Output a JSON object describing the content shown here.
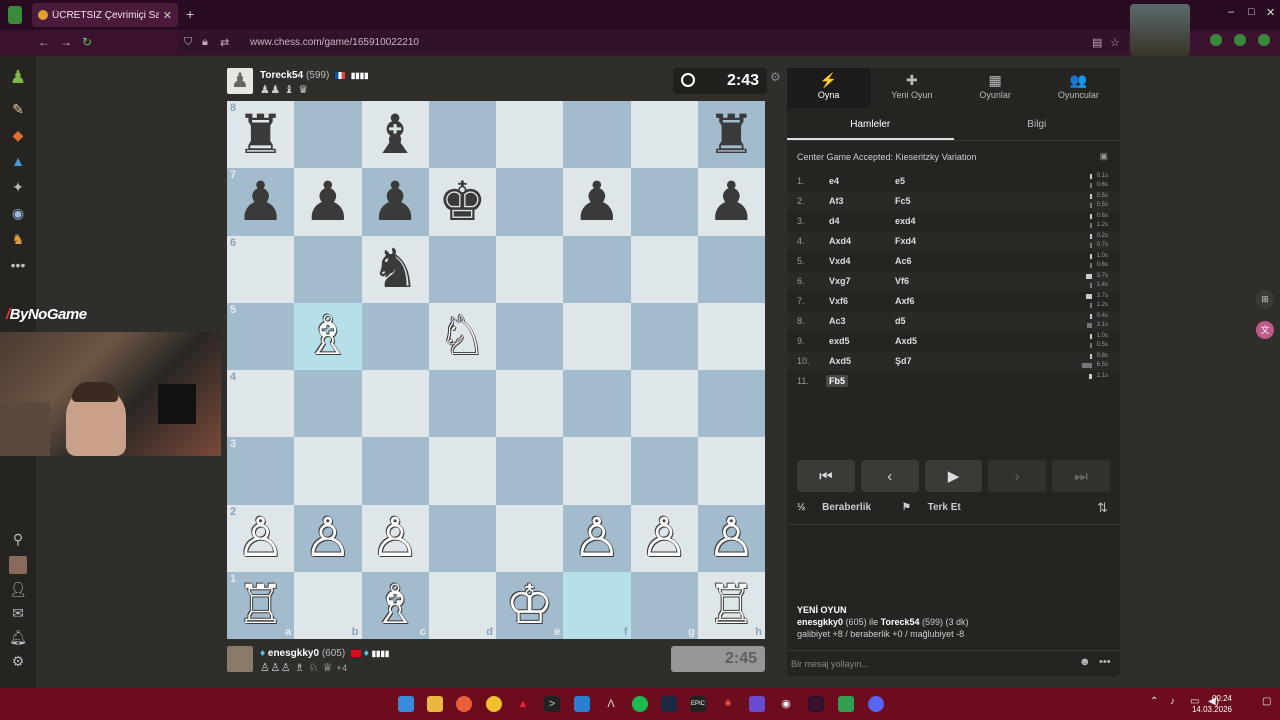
{
  "browser": {
    "tab_title": "ÜCRETSİZ Çevrimiçi Satranç",
    "url": "www.chess.com/game/165910022210"
  },
  "stream": {
    "brand": "ByNoGame",
    "brand_mark": "/"
  },
  "top_player": {
    "name": "Toreck54",
    "rating": "(599)",
    "captured": "♟♟ ♝ ♛",
    "clock": "2:43"
  },
  "bottom_player": {
    "name": "enesgkky0",
    "rating": "(605)",
    "captured": "♙♙♙ ♗ ♘ ♕",
    "advantage": "+4",
    "clock": "2:45"
  },
  "board": {
    "files": [
      "a",
      "b",
      "c",
      "d",
      "e",
      "f",
      "g",
      "h"
    ],
    "ranks": [
      "8",
      "7",
      "6",
      "5",
      "4",
      "3",
      "2",
      "1"
    ],
    "squares": [
      [
        "b:♜",
        "",
        "b:♝",
        "",
        "",
        "",
        "",
        "b:♜"
      ],
      [
        "b:♟",
        "b:♟",
        "b:♟",
        "b:♚",
        "",
        "b:♟",
        "",
        "b:♟"
      ],
      [
        "",
        "",
        "b:♞",
        "",
        "",
        "",
        "",
        ""
      ],
      [
        "",
        "w:♗",
        "",
        "w:♘",
        "",
        "",
        "",
        ""
      ],
      [
        "",
        "",
        "",
        "",
        "",
        "",
        "",
        ""
      ],
      [
        "",
        "",
        "",
        "",
        "",
        "",
        "",
        ""
      ],
      [
        "w:♙",
        "w:♙",
        "w:♙",
        "",
        "",
        "w:♙",
        "w:♙",
        "w:♙"
      ],
      [
        "w:♖",
        "",
        "w:♗",
        "",
        "w:♔",
        "",
        "",
        "w:♖"
      ]
    ],
    "highlight": [
      "b5",
      "f1"
    ]
  },
  "panel": {
    "nav": [
      {
        "icon": "⚡",
        "label": "Oyna"
      },
      {
        "icon": "✚",
        "label": "Yeni Oyun"
      },
      {
        "icon": "▦",
        "label": "Oyunlar"
      },
      {
        "icon": "👥",
        "label": "Oyuncular"
      }
    ],
    "subtabs": [
      "Hamleler",
      "Bilgi"
    ],
    "opening": "Center Game Accepted: Kieseritzky Variation",
    "moves": [
      {
        "n": "1.",
        "w": "e4",
        "b": "e5",
        "tw": "0.1s",
        "tb": "0.6s"
      },
      {
        "n": "2.",
        "w": "Af3",
        "b": "Fc5",
        "tw": "0.5s",
        "tb": "0.5s"
      },
      {
        "n": "3.",
        "w": "d4",
        "b": "exd4",
        "tw": "0.6s",
        "tb": "1.2s"
      },
      {
        "n": "4.",
        "w": "Axd4",
        "b": "Fxd4",
        "tw": "0.2s",
        "tb": "0.7s"
      },
      {
        "n": "5.",
        "w": "Vxd4",
        "b": "Ac6",
        "tw": "1.0s",
        "tb": "0.6s"
      },
      {
        "n": "6.",
        "w": "Vxg7",
        "b": "Vf6",
        "tw": "3.7s",
        "tb": "1.4s"
      },
      {
        "n": "7.",
        "w": "Vxf6",
        "b": "Axf6",
        "tw": "3.7s",
        "tb": "1.2s"
      },
      {
        "n": "8.",
        "w": "Ac3",
        "b": "d5",
        "tw": "0.4s",
        "tb": "3.1s"
      },
      {
        "n": "9.",
        "w": "exd5",
        "b": "Axd5",
        "tw": "1.0s",
        "tb": "0.5s"
      },
      {
        "n": "10.",
        "w": "Axd5",
        "b": "Şd7",
        "tw": "0.8s",
        "tb": "6.5s"
      },
      {
        "n": "11.",
        "w": "Fb5",
        "b": "",
        "tw": "2.1s",
        "tb": ""
      }
    ],
    "draw_label": "Beraberlik",
    "draw_icon": "½",
    "resign_label": "Terk Et",
    "new_game": {
      "heading": "YENİ OYUN",
      "p1": "enesgkky0",
      "p1_rating": "(605)",
      "join": "ile",
      "p2": "Toreck54",
      "p2_rating": "(599)",
      "time": "(3 dk)",
      "stats": "galibiyet +8 / beraberlik +0 / mağlubiyet -8"
    },
    "chat_placeholder": "Bir mesaj yollayın..."
  },
  "taskbar": {
    "time": "00:24",
    "date": "14.03.2026"
  },
  "colors": {
    "light": "#dfe6ea",
    "dark": "#a2bbcd",
    "highlight": "#b5e0ea",
    "taskbar": "#6d0c1c"
  }
}
